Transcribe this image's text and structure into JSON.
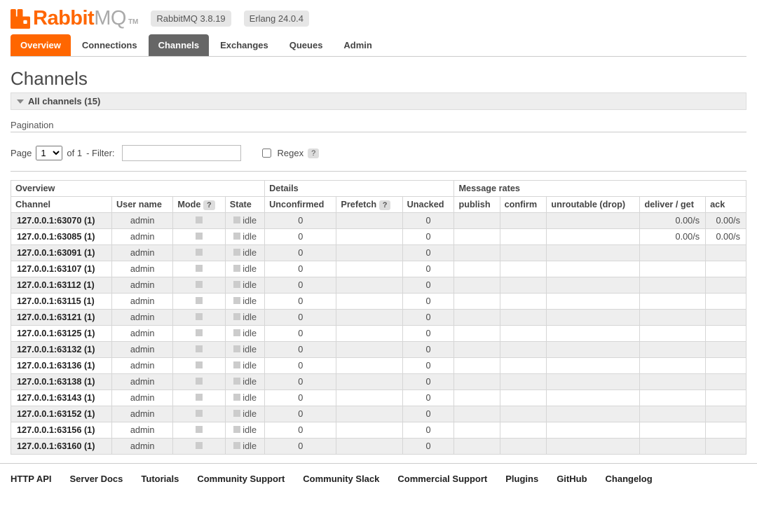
{
  "header": {
    "logo_rabbit": "Rabbit",
    "logo_mq": "MQ",
    "logo_tm": "TM",
    "version_rmq": "RabbitMQ 3.8.19",
    "version_erlang": "Erlang 24.0.4"
  },
  "tabs": [
    {
      "label": "Overview",
      "key": "overview"
    },
    {
      "label": "Connections",
      "key": "connections"
    },
    {
      "label": "Channels",
      "key": "channels"
    },
    {
      "label": "Exchanges",
      "key": "exchanges"
    },
    {
      "label": "Queues",
      "key": "queues"
    },
    {
      "label": "Admin",
      "key": "admin"
    }
  ],
  "title": "Channels",
  "section_header": "All channels (15)",
  "pagination_label": "Pagination",
  "pager": {
    "page_label": "Page",
    "current": "1",
    "of_label": "of 1",
    "filter_label": "- Filter:",
    "filter_value": "",
    "regex_label": "Regex",
    "qmark": "?"
  },
  "group_headers": {
    "overview": "Overview",
    "details": "Details",
    "rates": "Message rates"
  },
  "columns": {
    "channel": "Channel",
    "user": "User name",
    "mode": "Mode",
    "state": "State",
    "unconfirmed": "Unconfirmed",
    "prefetch": "Prefetch",
    "unacked": "Unacked",
    "publish": "publish",
    "confirm": "confirm",
    "unroutable": "unroutable (drop)",
    "deliver": "deliver / get",
    "ack": "ack",
    "qmark": "?"
  },
  "rows": [
    {
      "channel": "127.0.0.1:63070 (1)",
      "user": "admin",
      "state": "idle",
      "unconfirmed": "0",
      "prefetch": "",
      "unacked": "0",
      "publish": "",
      "confirm": "",
      "unroutable": "",
      "deliver": "0.00/s",
      "ack": "0.00/s"
    },
    {
      "channel": "127.0.0.1:63085 (1)",
      "user": "admin",
      "state": "idle",
      "unconfirmed": "0",
      "prefetch": "",
      "unacked": "0",
      "publish": "",
      "confirm": "",
      "unroutable": "",
      "deliver": "0.00/s",
      "ack": "0.00/s"
    },
    {
      "channel": "127.0.0.1:63091 (1)",
      "user": "admin",
      "state": "idle",
      "unconfirmed": "0",
      "prefetch": "",
      "unacked": "0",
      "publish": "",
      "confirm": "",
      "unroutable": "",
      "deliver": "",
      "ack": ""
    },
    {
      "channel": "127.0.0.1:63107 (1)",
      "user": "admin",
      "state": "idle",
      "unconfirmed": "0",
      "prefetch": "",
      "unacked": "0",
      "publish": "",
      "confirm": "",
      "unroutable": "",
      "deliver": "",
      "ack": ""
    },
    {
      "channel": "127.0.0.1:63112 (1)",
      "user": "admin",
      "state": "idle",
      "unconfirmed": "0",
      "prefetch": "",
      "unacked": "0",
      "publish": "",
      "confirm": "",
      "unroutable": "",
      "deliver": "",
      "ack": ""
    },
    {
      "channel": "127.0.0.1:63115 (1)",
      "user": "admin",
      "state": "idle",
      "unconfirmed": "0",
      "prefetch": "",
      "unacked": "0",
      "publish": "",
      "confirm": "",
      "unroutable": "",
      "deliver": "",
      "ack": ""
    },
    {
      "channel": "127.0.0.1:63121 (1)",
      "user": "admin",
      "state": "idle",
      "unconfirmed": "0",
      "prefetch": "",
      "unacked": "0",
      "publish": "",
      "confirm": "",
      "unroutable": "",
      "deliver": "",
      "ack": ""
    },
    {
      "channel": "127.0.0.1:63125 (1)",
      "user": "admin",
      "state": "idle",
      "unconfirmed": "0",
      "prefetch": "",
      "unacked": "0",
      "publish": "",
      "confirm": "",
      "unroutable": "",
      "deliver": "",
      "ack": ""
    },
    {
      "channel": "127.0.0.1:63132 (1)",
      "user": "admin",
      "state": "idle",
      "unconfirmed": "0",
      "prefetch": "",
      "unacked": "0",
      "publish": "",
      "confirm": "",
      "unroutable": "",
      "deliver": "",
      "ack": ""
    },
    {
      "channel": "127.0.0.1:63136 (1)",
      "user": "admin",
      "state": "idle",
      "unconfirmed": "0",
      "prefetch": "",
      "unacked": "0",
      "publish": "",
      "confirm": "",
      "unroutable": "",
      "deliver": "",
      "ack": ""
    },
    {
      "channel": "127.0.0.1:63138 (1)",
      "user": "admin",
      "state": "idle",
      "unconfirmed": "0",
      "prefetch": "",
      "unacked": "0",
      "publish": "",
      "confirm": "",
      "unroutable": "",
      "deliver": "",
      "ack": ""
    },
    {
      "channel": "127.0.0.1:63143 (1)",
      "user": "admin",
      "state": "idle",
      "unconfirmed": "0",
      "prefetch": "",
      "unacked": "0",
      "publish": "",
      "confirm": "",
      "unroutable": "",
      "deliver": "",
      "ack": ""
    },
    {
      "channel": "127.0.0.1:63152 (1)",
      "user": "admin",
      "state": "idle",
      "unconfirmed": "0",
      "prefetch": "",
      "unacked": "0",
      "publish": "",
      "confirm": "",
      "unroutable": "",
      "deliver": "",
      "ack": ""
    },
    {
      "channel": "127.0.0.1:63156 (1)",
      "user": "admin",
      "state": "idle",
      "unconfirmed": "0",
      "prefetch": "",
      "unacked": "0",
      "publish": "",
      "confirm": "",
      "unroutable": "",
      "deliver": "",
      "ack": ""
    },
    {
      "channel": "127.0.0.1:63160 (1)",
      "user": "admin",
      "state": "idle",
      "unconfirmed": "0",
      "prefetch": "",
      "unacked": "0",
      "publish": "",
      "confirm": "",
      "unroutable": "",
      "deliver": "",
      "ack": ""
    }
  ],
  "footer": [
    "HTTP API",
    "Server Docs",
    "Tutorials",
    "Community Support",
    "Community Slack",
    "Commercial Support",
    "Plugins",
    "GitHub",
    "Changelog"
  ]
}
